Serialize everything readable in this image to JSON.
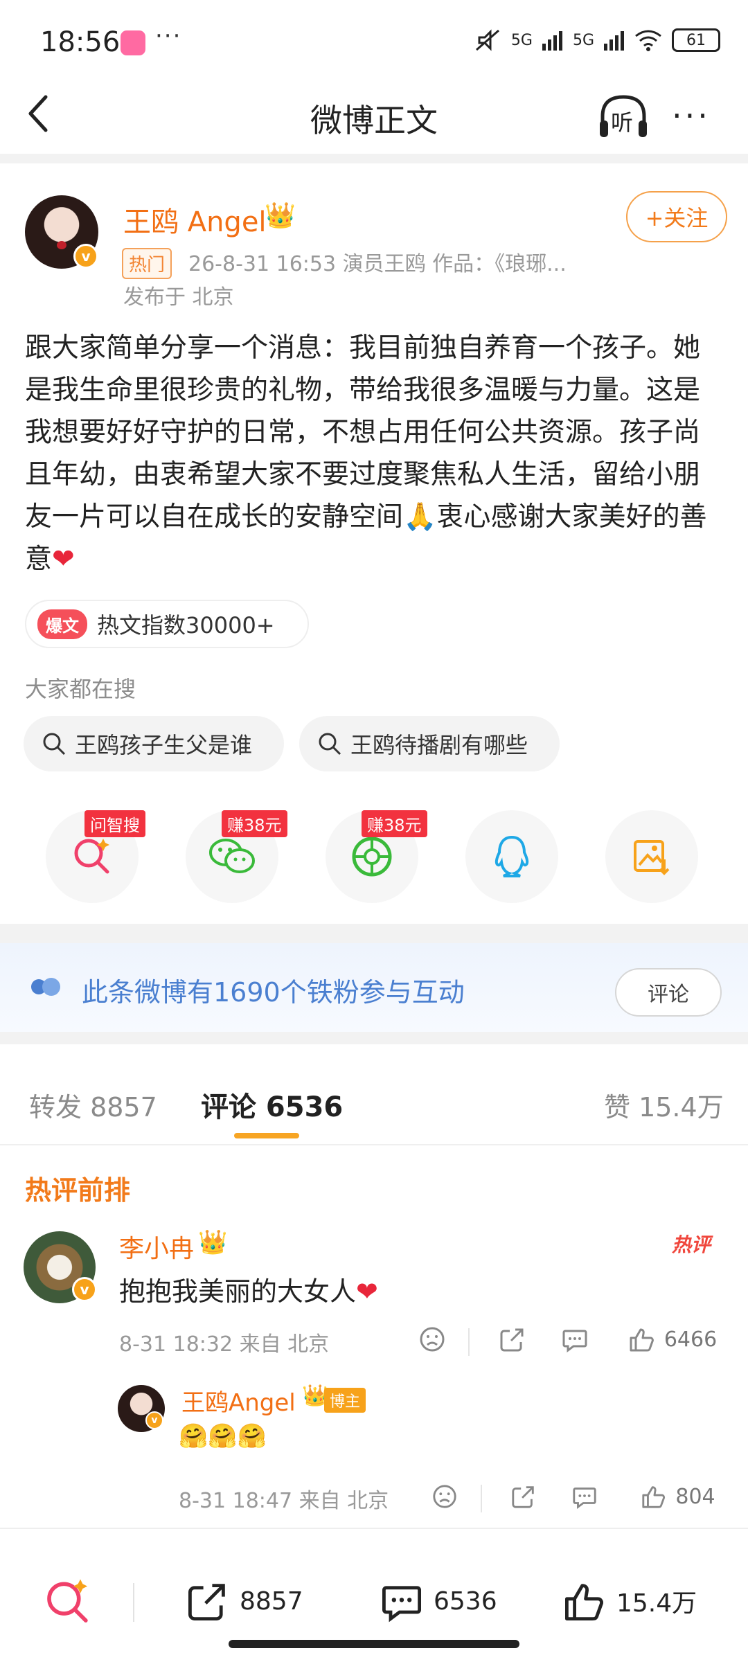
{
  "status": {
    "time": "18:56",
    "more": "···",
    "net1": "5G",
    "net2": "5G",
    "battery": "61"
  },
  "nav": {
    "title": "微博正文",
    "listen_label": "听",
    "more": "···"
  },
  "post": {
    "author": "王鸥 Angel",
    "hot_tag": "热门",
    "meta": "26-8-31 16:53   演员王鸥 作品：《琅琊...",
    "location": "发布于 北京",
    "follow": "+关注",
    "text": "跟大家简单分享一个消息：我目前独自养育一个孩子。她是我生命里很珍贵的礼物，带给我很多温暖与力量。这是我想要好好守护的日常，不想占用任何公共资源。孩子尚且年幼，由衷希望大家不要过度聚焦私人生活，留给小朋友一片可以自在成长的安静空间🙏衷心感谢大家美好的善意",
    "heart": "❤",
    "boom_label": "爆文",
    "hot_index": "热文指数30000+"
  },
  "search": {
    "heading": "大家都在搜",
    "chips": [
      "王鸥孩子生父是谁",
      "王鸥待播剧有哪些"
    ]
  },
  "share": {
    "tags": [
      "问智搜",
      "赚38元",
      "赚38元"
    ],
    "icons": [
      "zhisou-search-icon",
      "wechat-icon",
      "moments-icon",
      "qq-icon",
      "save-image-icon"
    ]
  },
  "fans": {
    "text": "此条微博有1690个铁粉参与互动",
    "button": "评论"
  },
  "tabs": {
    "repost": "转发 8857",
    "comment": "评论 6536",
    "like": "赞 15.4万"
  },
  "hot_comments": {
    "heading": "热评前排",
    "comment": {
      "name": "李小冉",
      "badge": "热评",
      "text": "抱抱我美丽的大女人",
      "heart": "❤",
      "meta": "8-31 18:32  来自 北京",
      "likes": "6466"
    },
    "reply": {
      "name": "王鸥Angel",
      "badge": "博主",
      "emoji": "🤗🤗🤗",
      "meta": "8-31 18:47  来自 北京",
      "likes": "804"
    }
  },
  "bottom": {
    "repost": "8857",
    "comment": "6536",
    "like": "15.4万"
  },
  "colors": {
    "accent_orange": "#f26f14",
    "link_blue": "#4a7fd0",
    "red": "#f2323f"
  }
}
